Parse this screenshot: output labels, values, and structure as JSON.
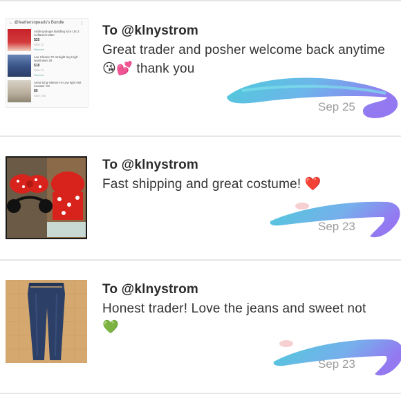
{
  "items": [
    {
      "to": "To @klnystrom",
      "message": "Great trader and posher welcome back anytime",
      "message_emoji": "😘💕",
      "message_tail": "thank you",
      "date": "Sep 25",
      "thumbnail_kind": "bundle-screenshot",
      "bundle": {
        "title": "@feathersnpearls's Bundle",
        "products": [
          {
            "title": "Anthropologie Building size US 2 Collared Halter",
            "price": "$25",
            "size": "Size: 2",
            "remove": "Remove"
          },
          {
            "title": "Lee Classic Fit straight leg High-waist jean 28",
            "price": "$18",
            "size": "Size: 2",
            "remove": "Remove"
          },
          {
            "title": "Aeria long-Sleeve Hi-Low light knit sweater XS",
            "price": "$9",
            "size": "Size: XS",
            "remove": "Remove"
          }
        ]
      }
    },
    {
      "to": "To @klnystrom",
      "message": "Fast shipping and great costume!",
      "message_emoji": "❤️",
      "message_tail": "",
      "date": "Sep 23",
      "thumbnail_kind": "minnie-costume-photo"
    },
    {
      "to": "To @klnystrom",
      "message": "Honest trader! Love the jeans and sweet not",
      "message_emoji": "💚",
      "message_tail": "",
      "date": "Sep 23",
      "thumbnail_kind": "jeans-photo"
    }
  ],
  "colors": {
    "separator": "#e6e6e6",
    "date_gray": "#9c9c9c",
    "scribble_cyan": "#3fc6d6",
    "scribble_purple": "#8a6df0",
    "heart_red": "#e2231a",
    "heart_green": "#5ccf1f"
  }
}
